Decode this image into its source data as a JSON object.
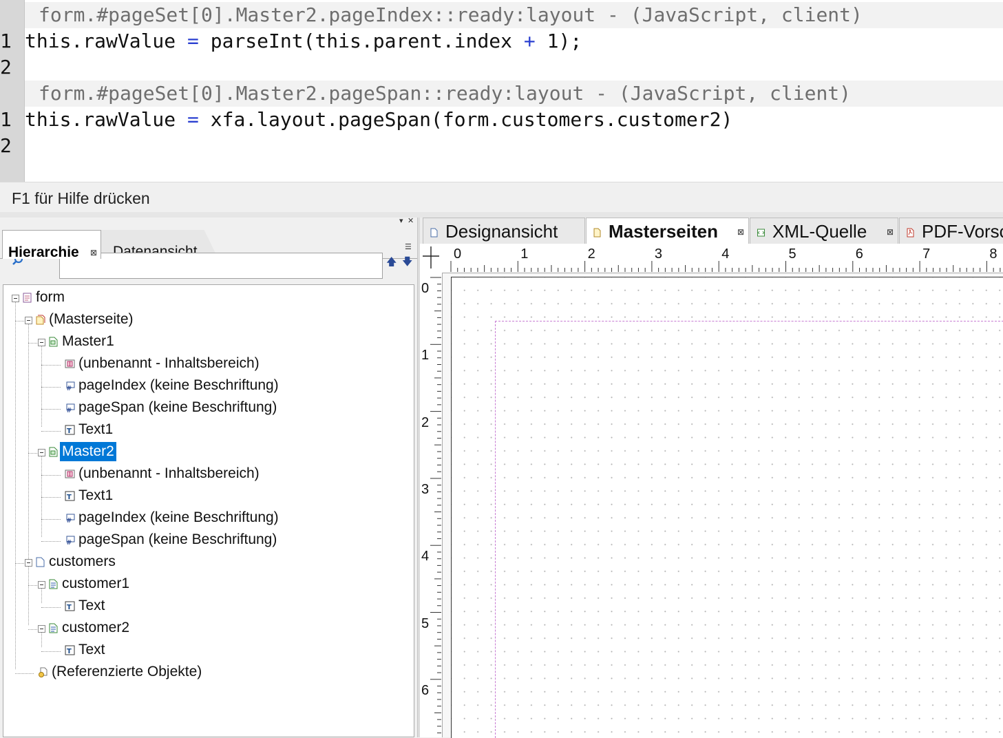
{
  "script_editor": {
    "blocks": [
      {
        "header": "form.#pageSet[0].Master2.pageIndex::ready:layout - (JavaScript, client)",
        "lines": [
          {
            "num": "1",
            "pre": "this.rawValue ",
            "op1": "=",
            "mid": " parseInt(this.parent.index ",
            "op2": "+",
            "post": " 1);"
          },
          {
            "num": "2",
            "text": ""
          }
        ]
      },
      {
        "header": "form.#pageSet[0].Master2.pageSpan::ready:layout - (JavaScript, client)",
        "lines": [
          {
            "num": "1",
            "pre": "this.rawValue ",
            "op1": "=",
            "post": " xfa.layout.pageSpan(form.customers.customer2)"
          },
          {
            "num": "2",
            "text": ""
          }
        ]
      }
    ]
  },
  "status_bar": {
    "text": "F1 für Hilfe drücken"
  },
  "hierarchy_panel": {
    "tabs": [
      {
        "label": "Hierarchie",
        "active": true
      },
      {
        "label": "Datenansicht",
        "active": false
      }
    ],
    "search": {
      "value": "",
      "placeholder": ""
    },
    "tree": [
      {
        "label": "form",
        "icon": "form-icon",
        "selected": false
      },
      {
        "label": "(Masterseite)",
        "icon": "master-pages-icon",
        "selected": false
      },
      {
        "label": "Master1",
        "icon": "master-page-icon",
        "selected": false
      },
      {
        "label": "(unbenannt - Inhaltsbereich)",
        "icon": "content-area-icon",
        "selected": false
      },
      {
        "label": "pageIndex (keine Beschriftung)",
        "icon": "numeric-field-icon",
        "selected": false
      },
      {
        "label": "pageSpan (keine Beschriftung)",
        "icon": "numeric-field-icon",
        "selected": false
      },
      {
        "label": "Text1",
        "icon": "text-object-icon",
        "selected": false
      },
      {
        "label": "Master2",
        "icon": "master-page-icon",
        "selected": true
      },
      {
        "label": "(unbenannt - Inhaltsbereich)",
        "icon": "content-area-icon",
        "selected": false
      },
      {
        "label": "Text1",
        "icon": "text-object-icon",
        "selected": false
      },
      {
        "label": "pageIndex (keine Beschriftung)",
        "icon": "numeric-field-icon",
        "selected": false
      },
      {
        "label": "pageSpan (keine Beschriftung)",
        "icon": "numeric-field-icon",
        "selected": false
      },
      {
        "label": "customers",
        "icon": "page-icon",
        "selected": false
      },
      {
        "label": "customer1",
        "icon": "subform-icon",
        "selected": false
      },
      {
        "label": "Text",
        "icon": "text-object-icon",
        "selected": false
      },
      {
        "label": "customer2",
        "icon": "subform-icon",
        "selected": false
      },
      {
        "label": "Text",
        "icon": "text-object-icon",
        "selected": false
      },
      {
        "label": "(Referenzierte Objekte)",
        "icon": "referenced-objects-icon",
        "selected": false
      }
    ]
  },
  "design_area": {
    "tabs": [
      {
        "label": "Designansicht",
        "active": false,
        "icon": "page-icon"
      },
      {
        "label": "Masterseiten",
        "active": true,
        "icon": "master-page-icon"
      },
      {
        "label": "XML-Quelle",
        "active": false,
        "icon": "xml-icon"
      },
      {
        "label": "PDF-Vorsc",
        "active": false,
        "icon": "pdf-icon"
      }
    ],
    "ruler_h_numbers": [
      "0",
      "1",
      "2",
      "3",
      "4",
      "5",
      "6",
      "7",
      "8"
    ],
    "ruler_v_numbers": [
      "0",
      "1",
      "2",
      "3",
      "4",
      "5",
      "6"
    ]
  },
  "colors": {
    "selection": "#0078d7",
    "operator": "#2a3fd0",
    "content_area_border": "#c77ad3",
    "gutter": "#d7d7d7"
  }
}
